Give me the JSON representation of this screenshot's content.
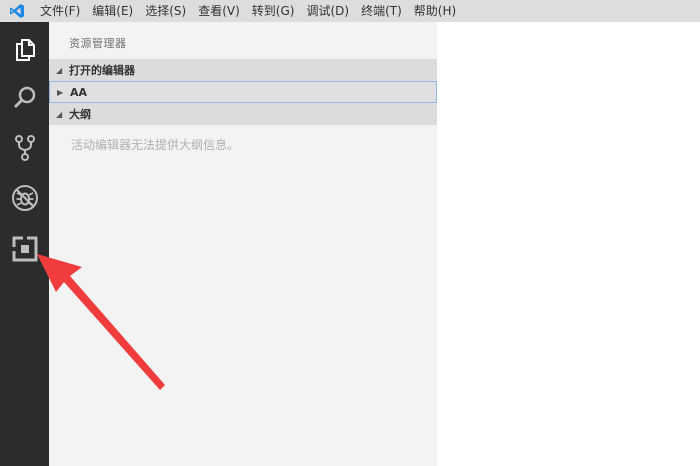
{
  "menubar": {
    "logo_icon": "vscode-logo-icon",
    "items": [
      "文件(F)",
      "编辑(E)",
      "选择(S)",
      "查看(V)",
      "转到(G)",
      "调试(D)",
      "终端(T)",
      "帮助(H)"
    ]
  },
  "activitybar": {
    "icons": [
      "explorer-icon",
      "search-icon",
      "source-control-icon",
      "debug-icon",
      "extensions-icon"
    ]
  },
  "sidebar": {
    "title": "资源管理器",
    "sections": {
      "open_editors": "打开的编辑器",
      "folder": "AA",
      "outline": "大纲"
    },
    "outline_message": "活动编辑器无法提供大纲信息。"
  },
  "colors": {
    "menubar_bg": "#dddddd",
    "activitybar_bg": "#2c2c2c",
    "sidebar_bg": "#f3f3f3",
    "annotation_arrow": "#f03c3c",
    "logo_blue": "#1e88e5"
  }
}
